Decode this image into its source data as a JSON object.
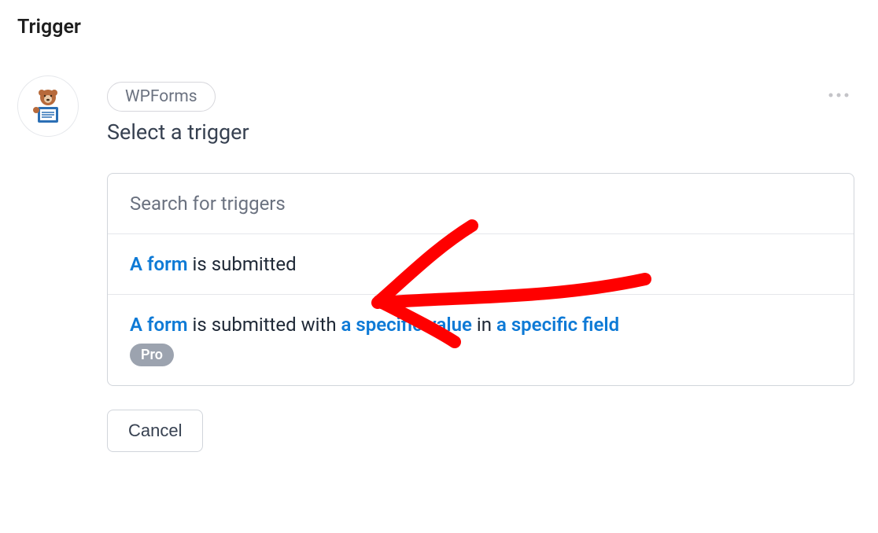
{
  "page_title": "Trigger",
  "integration_chip": "WPForms",
  "section_title": "Select a trigger",
  "search_placeholder": "Search for triggers",
  "options": [
    {
      "parts": [
        {
          "text": "A form",
          "style": "blue"
        },
        {
          "text": " is submitted",
          "style": "gray"
        }
      ],
      "pro": false
    },
    {
      "parts": [
        {
          "text": "A form",
          "style": "blue"
        },
        {
          "text": " is submitted with ",
          "style": "gray"
        },
        {
          "text": "a specific value",
          "style": "blue"
        },
        {
          "text": " in ",
          "style": "gray"
        },
        {
          "text": "a specific field",
          "style": "blue"
        }
      ],
      "pro": true,
      "pro_label": "Pro"
    }
  ],
  "cancel_label": "Cancel",
  "annotation": {
    "type": "hand-drawn-arrow",
    "color": "#ff0000",
    "points_to": "option-0"
  }
}
